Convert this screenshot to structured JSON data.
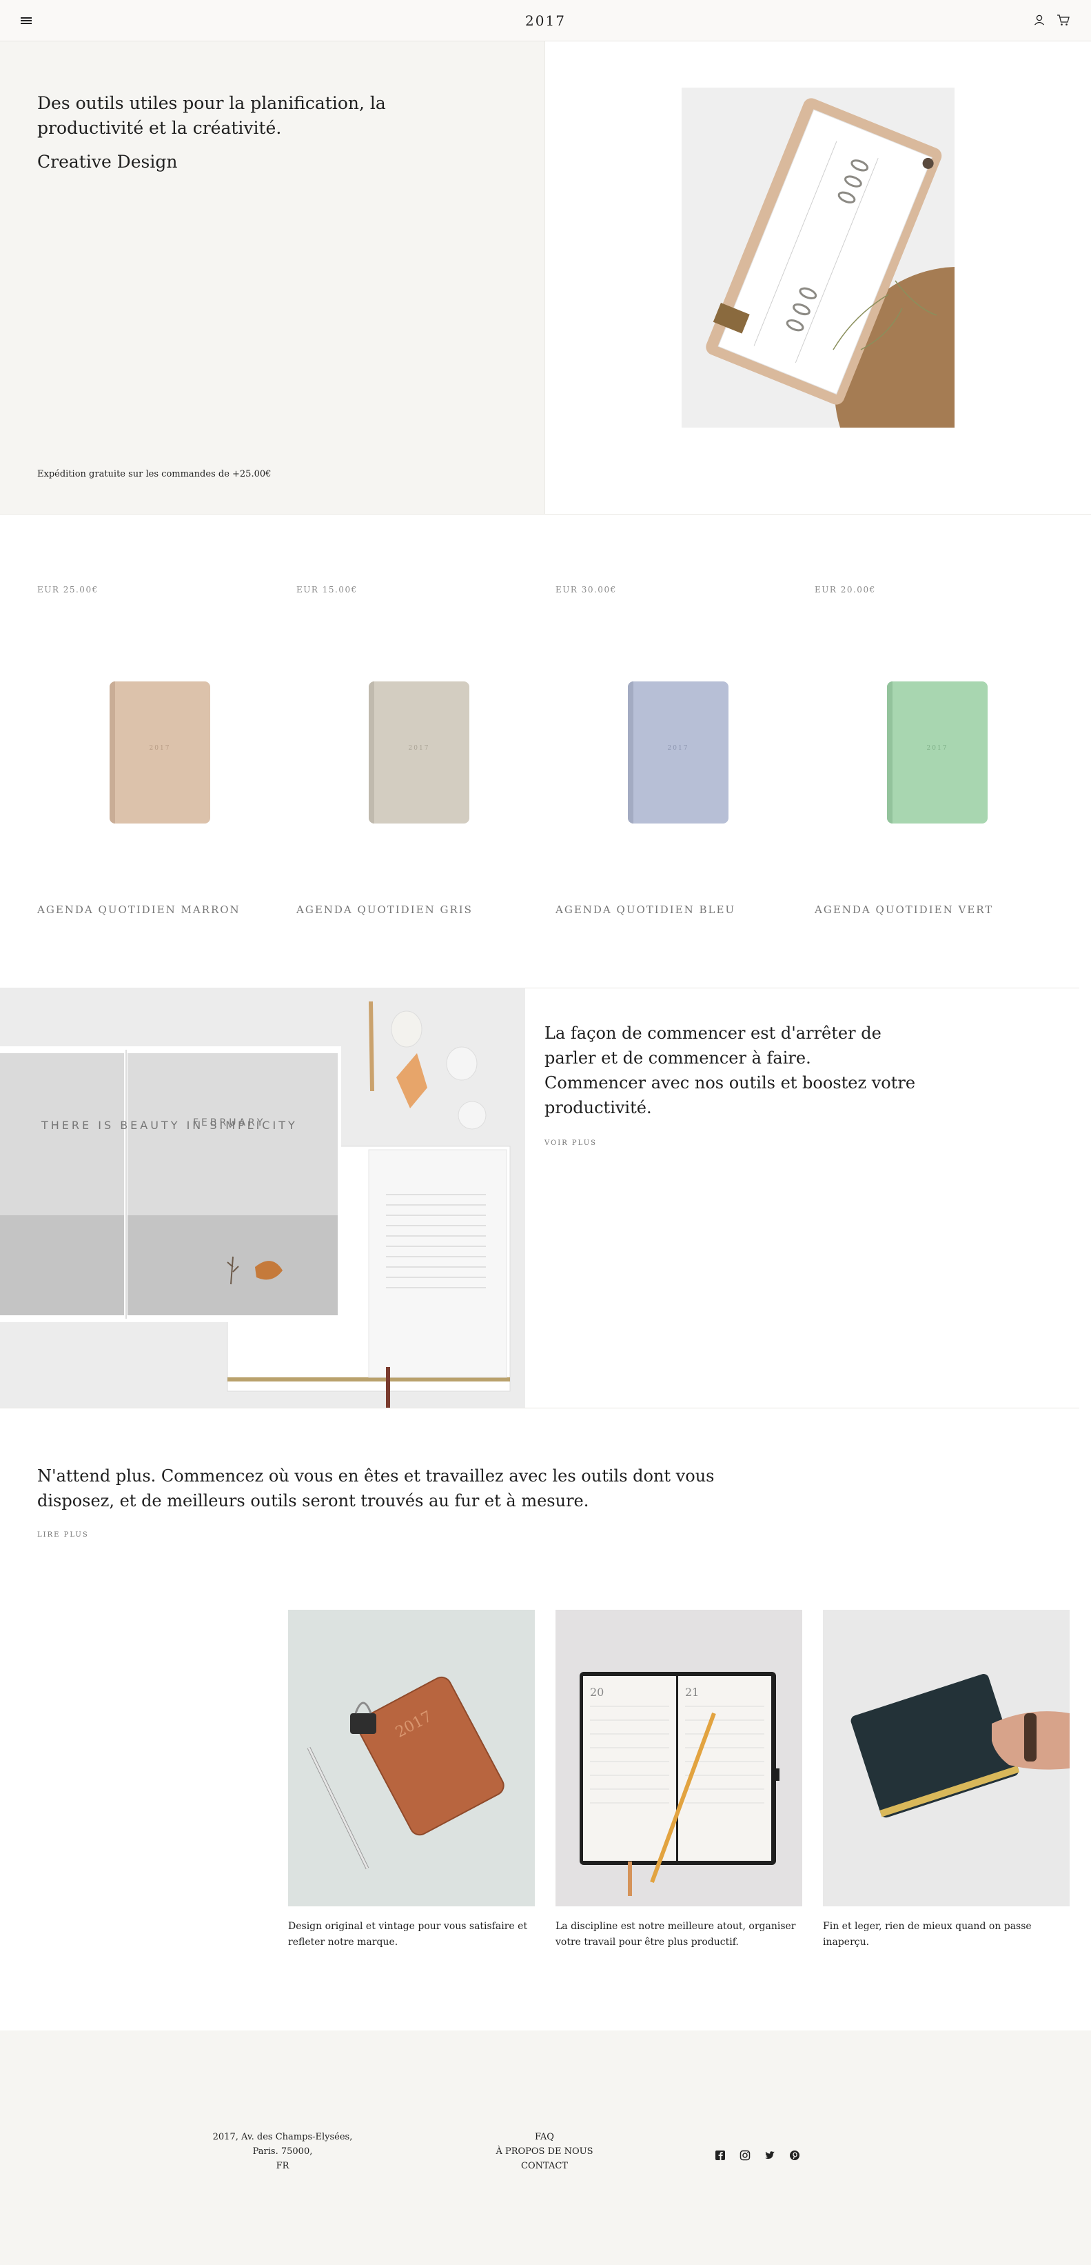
{
  "header": {
    "logo": "2017",
    "menu_icon": "hamburger-menu-icon",
    "account_icon": "user-icon",
    "cart_icon": "cart-icon"
  },
  "hero": {
    "title": "Des outils utiles pour la planification, la productivité et la créativité.",
    "subtitle": "Creative Design",
    "shipping_note": "Expédition gratuite sur les commandes de +25.00€"
  },
  "products": [
    {
      "price": "EUR 25.00€",
      "name": "AGENDA QUOTIDIEN MARRON",
      "color": "#dcc2ab",
      "cover_text": "2017"
    },
    {
      "price": "EUR 15.00€",
      "name": "AGENDA QUOTIDIEN GRIS",
      "color": "#d3cdc1",
      "cover_text": "2017"
    },
    {
      "price": "EUR 30.00€",
      "name": "AGENDA QUOTIDIEN BLEU",
      "color": "#b7bfd6",
      "cover_text": "2017"
    },
    {
      "price": "EUR 20.00€",
      "name": "AGENDA QUOTIDIEN VERT",
      "color": "#a8d6b0",
      "cover_text": "2017"
    }
  ],
  "feature": {
    "text": "La façon de commencer est d'arrêter de parler et de commencer à faire. Commencer avec nos outils et boostez votre productivité.",
    "link": "VOIR PLUS",
    "image_text": {
      "left_page": "THERE IS BEAUTY IN SIMPLICITY",
      "right_page": "FEBRUARY"
    }
  },
  "quote": {
    "text": "N'attend plus. Commencez où vous en êtes et travaillez avec les outils dont vous disposez, et de meilleurs outils seront trouvés au fur et à mesure.",
    "link": "LIRE PLUS"
  },
  "gallery": [
    {
      "caption": "Design original et vintage pour vous satisfaire et refleter notre marque.",
      "cover_text": "2017"
    },
    {
      "caption": "La discipline est notre meilleure atout, organiser votre travail pour être plus productif.",
      "page_left": "20",
      "page_right": "21"
    },
    {
      "caption": "Fin et leger, rien de mieux quand on passe inaperçu."
    }
  ],
  "footer": {
    "address_line1": "2017, Av. des Champs-Elysées,",
    "address_line2": "Paris. 75000,",
    "address_line3": "FR",
    "links": [
      "FAQ",
      "À PROPOS DE NOUS",
      "CONTACT"
    ],
    "social_icons": [
      "facebook-icon",
      "instagram-icon",
      "twitter-icon",
      "pinterest-icon"
    ]
  },
  "colors": {
    "accent_bg": "#f6f5f2",
    "text": "#1f1f1f",
    "muted": "#8b8b8b"
  }
}
